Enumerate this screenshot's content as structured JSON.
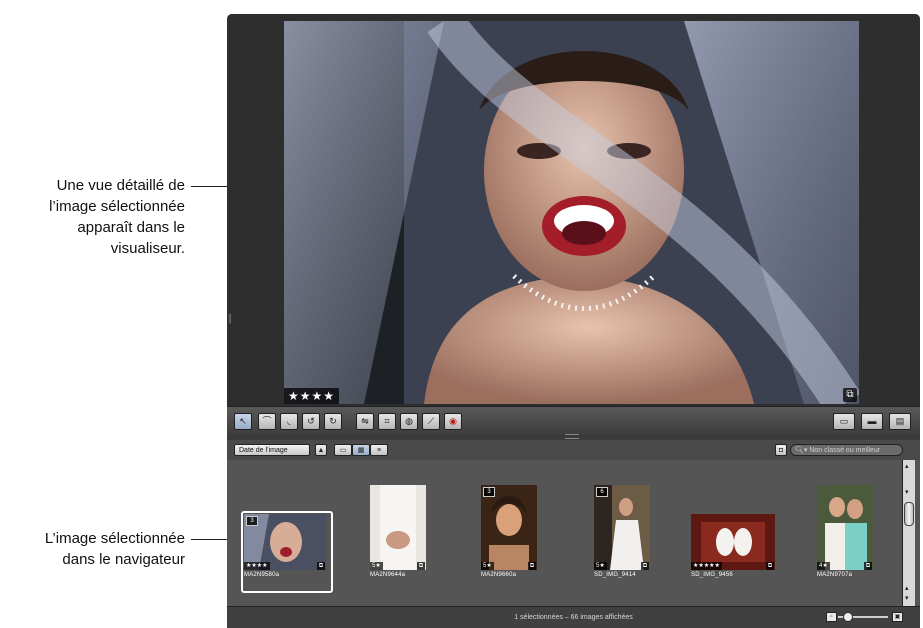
{
  "callouts": {
    "viewer": [
      "Une vue détaillé de",
      "l’image sélectionnée",
      "apparaît dans le",
      "visualiseur."
    ],
    "browser": [
      "L’image sélectionnée",
      "dans le navigateur"
    ]
  },
  "viewer": {
    "rating": "★★★★",
    "stack_icon": "stack-icon"
  },
  "toolbar": {
    "tools": [
      "selection-arrow-icon",
      "lift-tool-icon",
      "stamp-tool-icon",
      "rotate-left-icon",
      "rotate-right-icon",
      "straighten-icon",
      "crop-icon",
      "spot-patch-icon",
      "brush-icon",
      "red-eye-icon"
    ],
    "right_tools": [
      "viewer-mode-icon",
      "browser-mode-icon",
      "split-view-icon"
    ]
  },
  "browser_bar": {
    "sort_label": "Date de l’image",
    "sort_arrow": "▲",
    "search_placeholder": "Non classé ou meilleur"
  },
  "thumbnails": [
    {
      "name": "MA2N9580a",
      "stars": "★★★★",
      "stack": "3",
      "selected": true
    },
    {
      "name": "MA2N9644a",
      "stars": "5★",
      "stack": "",
      "selected": false
    },
    {
      "name": "MA2N9660a",
      "stars": "5★",
      "stack": "3",
      "selected": false
    },
    {
      "name": "SD_IMG_9414",
      "stars": "5★",
      "stack": "6",
      "selected": false
    },
    {
      "name": "SD_IMG_9456",
      "stars": "★★★★★",
      "stack": "",
      "selected": false
    },
    {
      "name": "MA2N9707a",
      "stars": "4★",
      "stack": "",
      "selected": false
    }
  ],
  "status": {
    "text": "1 sélectionnées – 66 images affichées"
  },
  "zoom": {
    "level": 0.12
  }
}
